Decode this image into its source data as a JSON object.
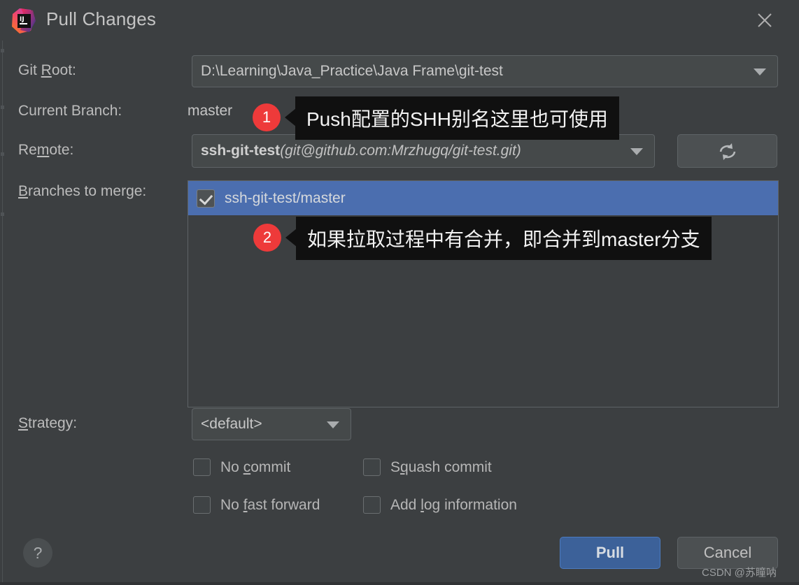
{
  "window": {
    "title": "Pull Changes",
    "app_icon": "intellij-idea-logo",
    "close_icon": "close-icon"
  },
  "form": {
    "git_root": {
      "label": "Git Root:",
      "mnemonic": "R",
      "value": "D:\\Learning\\Java_Practice\\Java Frame\\git-test",
      "dropdown_icon": "chevron-down-icon"
    },
    "current_branch": {
      "label": "Current Branch:",
      "value": "master"
    },
    "remote": {
      "label": "Remote:",
      "mnemonic": "m",
      "value_name": "ssh-git-test",
      "value_url": "(git@github.com:Mrzhugq/git-test.git)",
      "dropdown_icon": "chevron-down-icon",
      "refresh_icon": "refresh-icon"
    },
    "branches_to_merge": {
      "label": "Branches to merge:",
      "mnemonic": "B",
      "items": [
        {
          "label": "ssh-git-test/master",
          "checked": true,
          "selected": true
        }
      ]
    },
    "strategy": {
      "label": "Strategy:",
      "mnemonic": "S",
      "value": "<default>",
      "dropdown_icon": "chevron-down-icon"
    },
    "options": [
      {
        "label": "No commit",
        "checked": false
      },
      {
        "label": "Squash commit",
        "checked": false
      },
      {
        "label": "No fast forward",
        "checked": false
      },
      {
        "label": "Add log information",
        "checked": false
      }
    ]
  },
  "buttons": {
    "help": "?",
    "pull": "Pull",
    "cancel": "Cancel"
  },
  "annotations": [
    {
      "number": "1",
      "text": "Push配置的SHH别名这里也可使用"
    },
    {
      "number": "2",
      "text": "如果拉取过程中有合并，即合并到master分支"
    }
  ],
  "watermark": "CSDN @苏瞳呐",
  "colors": {
    "dialog_bg": "#3C3F41",
    "field_bg": "#45494A",
    "selection_blue": "#4B6EAF",
    "primary_button": "#3C6199",
    "badge_red": "#EE3A3A",
    "tooltip_bg": "#101010"
  }
}
